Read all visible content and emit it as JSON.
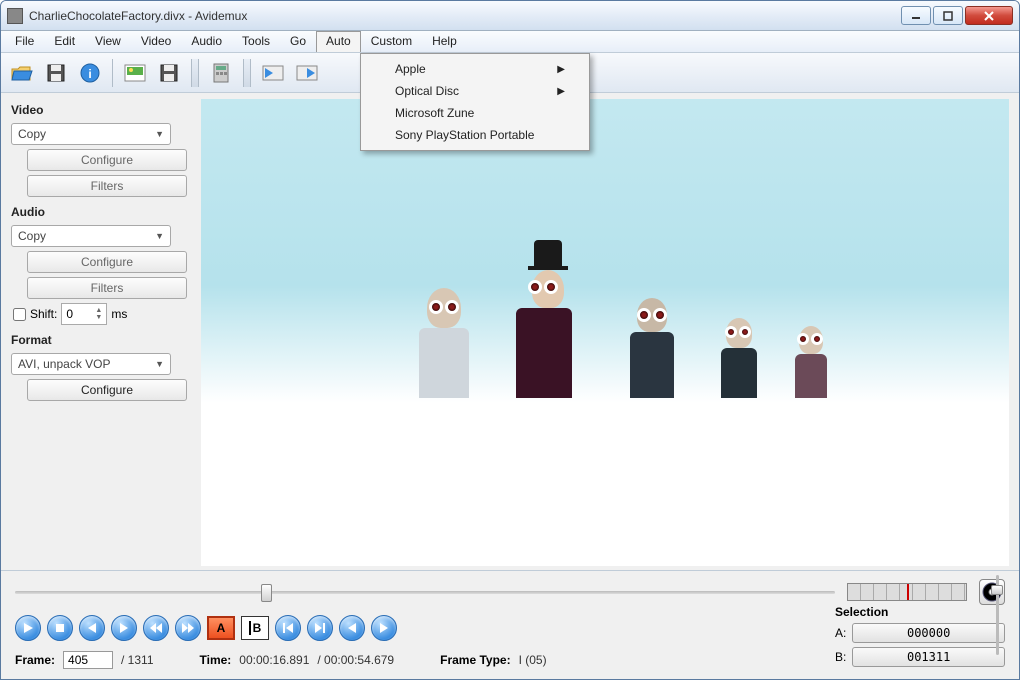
{
  "window": {
    "title": "CharlieChocolateFactory.divx - Avidemux"
  },
  "menubar": {
    "items": [
      "File",
      "Edit",
      "View",
      "Video",
      "Audio",
      "Tools",
      "Go",
      "Auto",
      "Custom",
      "Help"
    ],
    "open_index": 7
  },
  "auto_menu": {
    "items": [
      {
        "label": "Apple",
        "has_submenu": true
      },
      {
        "label": "Optical Disc",
        "has_submenu": true
      },
      {
        "label": "Microsoft Zune",
        "has_submenu": false
      },
      {
        "label": "Sony PlayStation Portable",
        "has_submenu": false
      }
    ]
  },
  "sidebar": {
    "video_label": "Video",
    "video_codec": "Copy",
    "video_configure": "Configure",
    "video_filters": "Filters",
    "audio_label": "Audio",
    "audio_codec": "Copy",
    "audio_configure": "Configure",
    "audio_filters": "Filters",
    "shift_label": "Shift:",
    "shift_value": "0",
    "shift_unit": "ms",
    "format_label": "Format",
    "format_value": "AVI, unpack VOP",
    "format_configure": "Configure"
  },
  "transport": {
    "marker_a": "A",
    "marker_b": "B"
  },
  "selection": {
    "title": "Selection",
    "a_label": "A:",
    "a_value": "000000",
    "b_label": "B:",
    "b_value": "001311"
  },
  "status": {
    "frame_label": "Frame:",
    "frame_value": "405",
    "frame_total": "/ 1311",
    "time_label": "Time:",
    "time_value": "00:00:16.891",
    "time_total": "/ 00:00:54.679",
    "frametype_label": "Frame Type:",
    "frametype_value": "I (05)"
  }
}
